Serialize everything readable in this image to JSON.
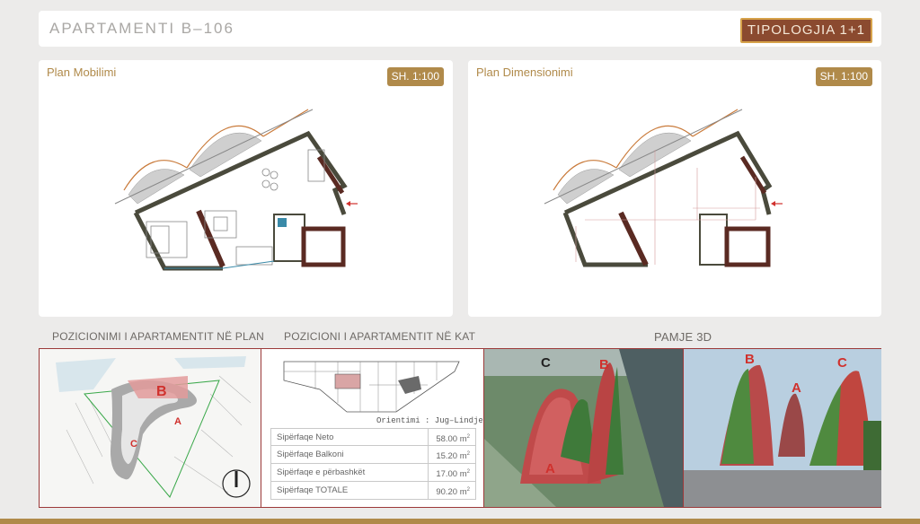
{
  "header": {
    "title": "APARTAMENTI  B–106",
    "typology": "TIPOLOGJIA  1+1"
  },
  "plans": {
    "furniture": {
      "title": "Plan Mobilimi",
      "scale": "SH. 1:100"
    },
    "dimension": {
      "title": "Plan Dimensionimi",
      "scale": "SH. 1:100"
    }
  },
  "sections": {
    "position_plan": "POZICIONIMI I APARTAMENTIT NË PLAN",
    "position_floor": "POZICIONI I APARTAMENTIT NË KAT",
    "view_3d": "PAMJE 3D"
  },
  "site_plan": {
    "labels": {
      "a": "A",
      "b": "B",
      "c": "C"
    }
  },
  "floor": {
    "orientation": "Orientimi : Jug–Lindje",
    "areas": [
      {
        "label": "Sipërfaqe Neto",
        "value": "58.00",
        "unit": "m"
      },
      {
        "label": "Sipërfaqe Balkoni",
        "value": "15.20",
        "unit": "m"
      },
      {
        "label": "Sipërfaqe e përbashkët",
        "value": "17.00",
        "unit": "m"
      },
      {
        "label": "Sipërfaqe TOTALE",
        "value": "90.20",
        "unit": "m"
      }
    ],
    "unit_sup": "2"
  },
  "renders": {
    "aerial": {
      "a": "A",
      "b": "B",
      "c": "C"
    },
    "street": {
      "a": "A",
      "b": "B",
      "c": "C"
    }
  },
  "colors": {
    "accent_gold": "#b08a4a",
    "badge_brown": "#8b4a2f",
    "frame_red": "#9c3a3a",
    "wall_dark": "#4a4a3c",
    "label_red": "#d0312d"
  },
  "icons": [
    "north-arrow-icon",
    "entrance-arrow-icon"
  ]
}
